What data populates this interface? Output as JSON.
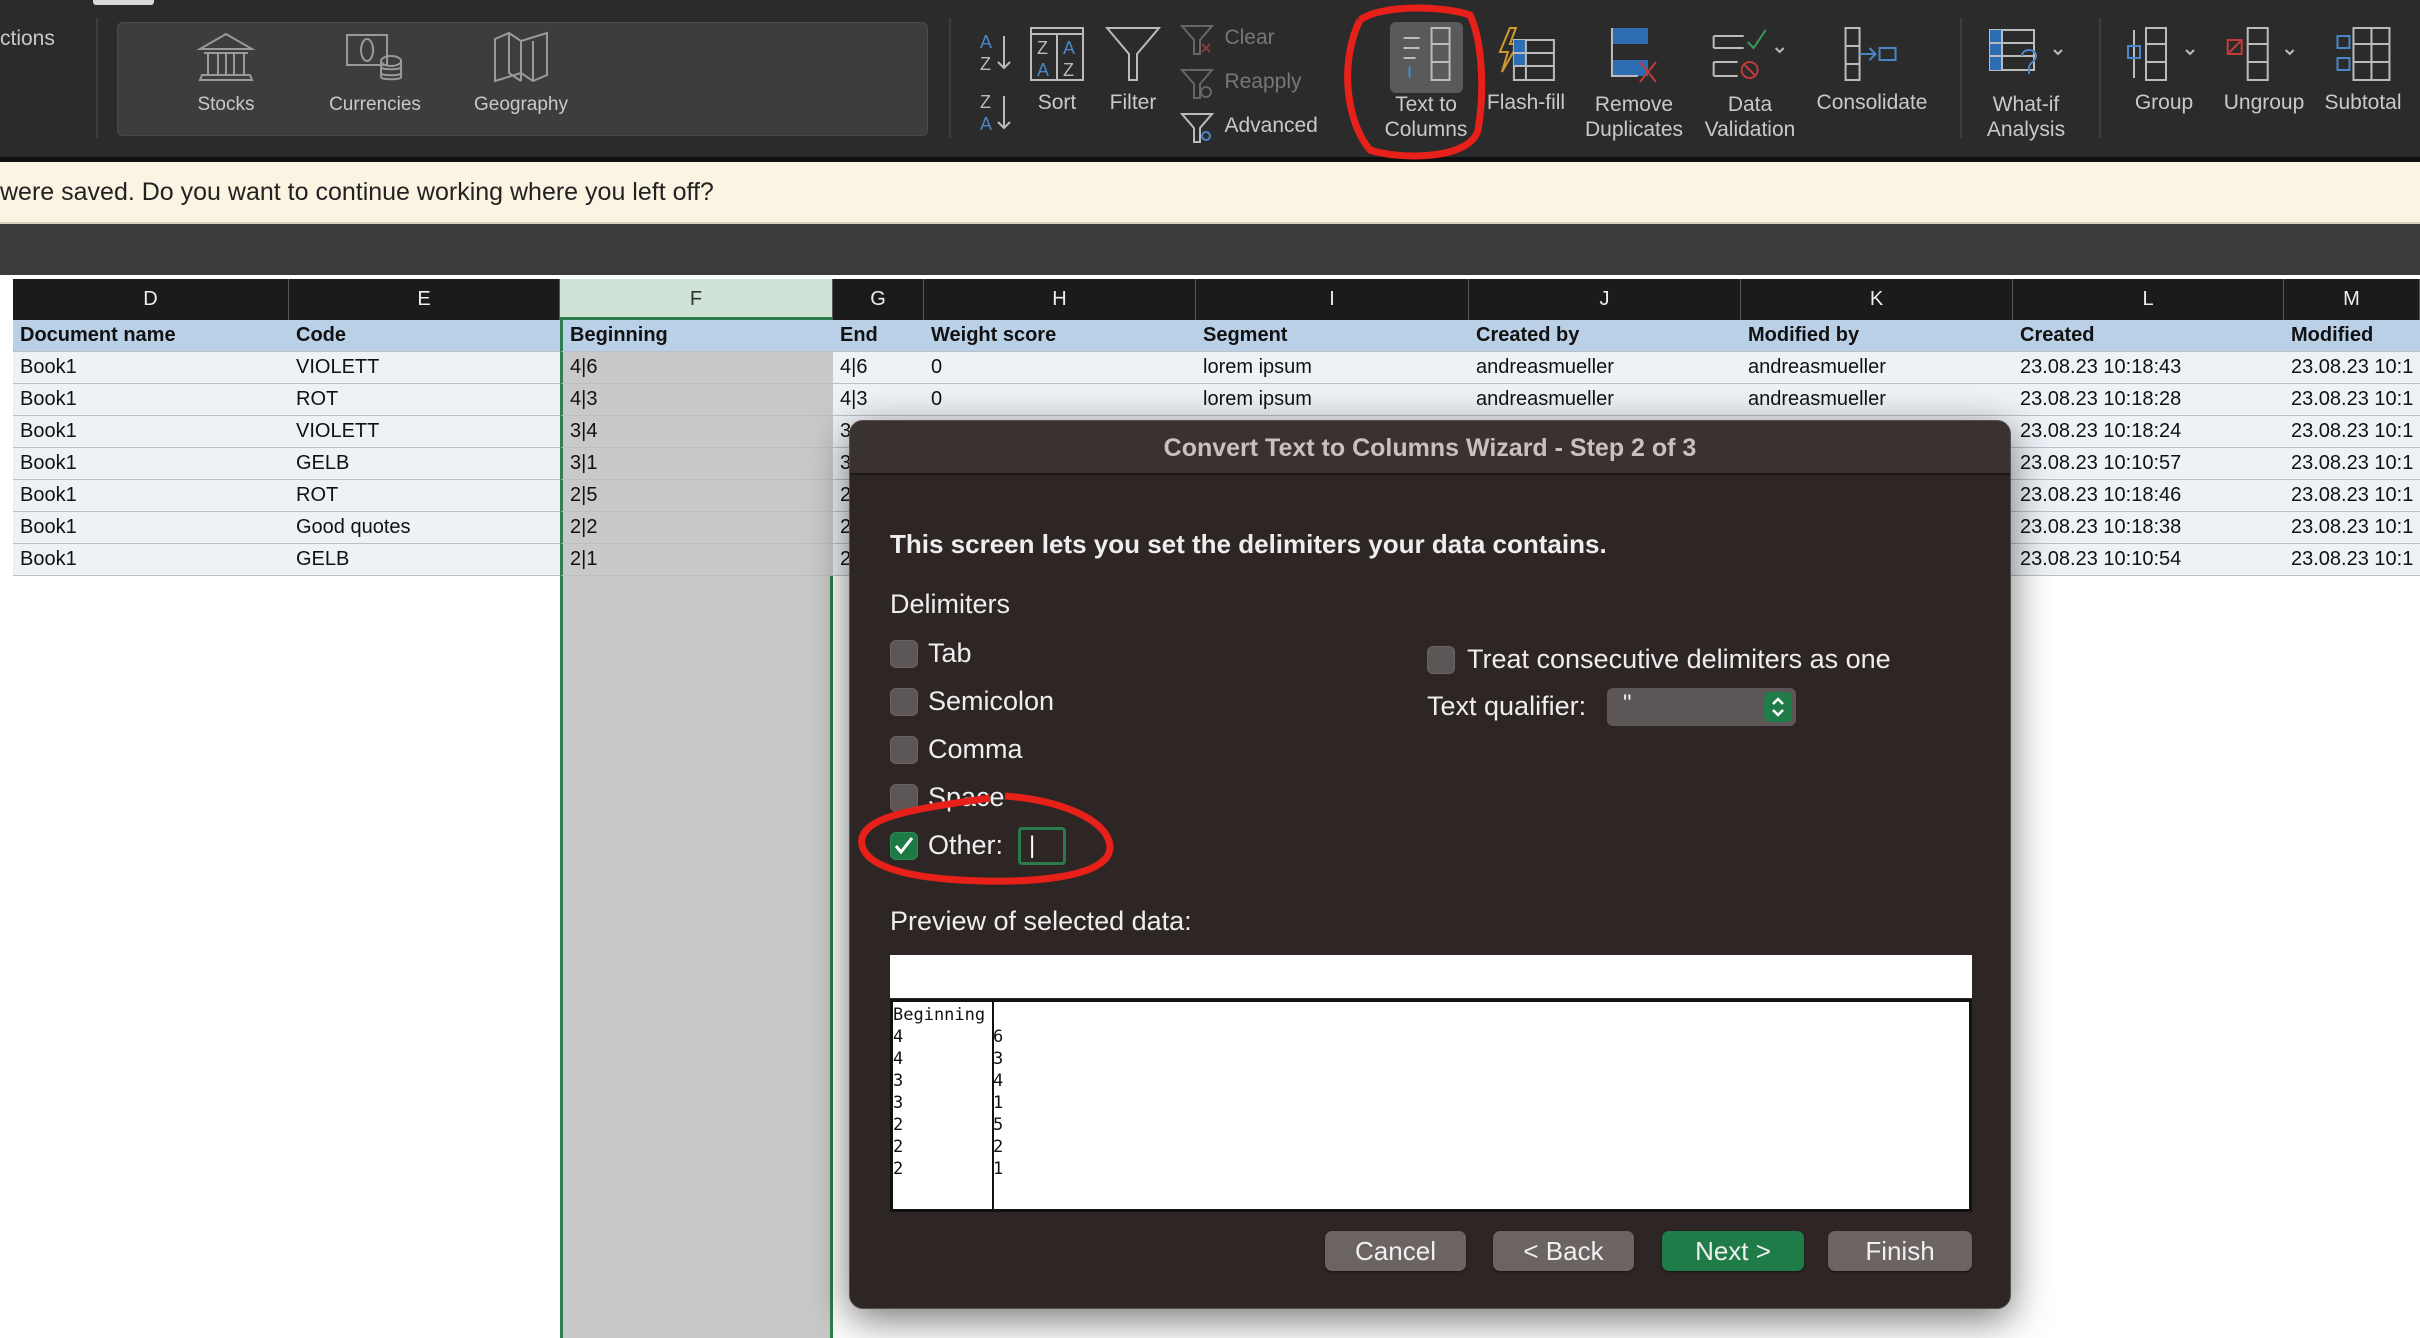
{
  "toolbar": {
    "left_cut_label": "ctions",
    "data_types": [
      {
        "label": "Stocks",
        "icon": "bank-icon"
      },
      {
        "label": "Currencies",
        "icon": "currency-icon"
      },
      {
        "label": "Geography",
        "icon": "map-icon"
      }
    ],
    "sort": "Sort",
    "filter": "Filter",
    "clear": "Clear",
    "reapply": "Reapply",
    "advanced": "Advanced",
    "text_to_columns": [
      "Text to",
      "Columns"
    ],
    "flash_fill": "Flash-fill",
    "remove_duplicates": [
      "Remove",
      "Duplicates"
    ],
    "data_validation": [
      "Data",
      "Validation"
    ],
    "consolidate": "Consolidate",
    "what_if": [
      "What-if",
      "Analysis"
    ],
    "group": "Group",
    "ungroup": "Ungroup",
    "subtotal": "Subtotal"
  },
  "notification": "were saved. Do you want to continue working where you left off?",
  "sheet": {
    "column_letters": [
      "D",
      "E",
      "F",
      "G",
      "H",
      "I",
      "J",
      "K",
      "L",
      "M"
    ],
    "headers": [
      "Document name",
      "Code",
      "Beginning",
      "End",
      "Weight score",
      "Segment",
      "Created by",
      "Modified by",
      "Created",
      "Modified"
    ],
    "rows": [
      [
        "Book1",
        "VIOLETT",
        "4|6",
        "4|6",
        "0",
        "lorem ipsum",
        "andreasmueller",
        "andreasmueller",
        "23.08.23 10:18:43",
        "23.08.23 10:1"
      ],
      [
        "Book1",
        "ROT",
        "4|3",
        "4|3",
        "0",
        "lorem ipsum",
        "andreasmueller",
        "andreasmueller",
        "23.08.23 10:18:28",
        "23.08.23 10:1"
      ],
      [
        "Book1",
        "VIOLETT",
        "3|4",
        "3",
        "",
        "",
        "",
        "",
        "23.08.23 10:18:24",
        "23.08.23 10:1"
      ],
      [
        "Book1",
        "GELB",
        "3|1",
        "3",
        "",
        "",
        "",
        "",
        "23.08.23 10:10:57",
        "23.08.23 10:1"
      ],
      [
        "Book1",
        "ROT",
        "2|5",
        "2",
        "",
        "",
        "",
        "",
        "23.08.23 10:18:46",
        "23.08.23 10:1"
      ],
      [
        "Book1",
        "Good quotes",
        "2|2",
        "2",
        "",
        "",
        "",
        "",
        "23.08.23 10:18:38",
        "23.08.23 10:1"
      ],
      [
        "Book1",
        "GELB",
        "2|1",
        "2",
        "",
        "",
        "",
        "",
        "23.08.23 10:10:54",
        "23.08.23 10:1"
      ]
    ]
  },
  "dialog": {
    "title": "Convert Text to Columns Wizard - Step 2 of 3",
    "instruction": "This screen lets you set the delimiters your data contains.",
    "delimiters_label": "Delimiters",
    "delimiters": [
      {
        "label": "Tab",
        "checked": false
      },
      {
        "label": "Semicolon",
        "checked": false
      },
      {
        "label": "Comma",
        "checked": false
      },
      {
        "label": "Space",
        "checked": false
      },
      {
        "label": "Other:",
        "checked": true
      }
    ],
    "other_value": "|",
    "treat_consecutive": {
      "label": "Treat consecutive delimiters as one",
      "checked": false
    },
    "text_qualifier_label": "Text qualifier:",
    "text_qualifier_value": "\"",
    "preview_label": "Preview of selected data:",
    "preview": {
      "col1": "Beginning\n4\n4\n3\n3\n2\n2\n2",
      "col2": "\n6\n3\n4\n1\n5\n2\n1"
    },
    "buttons": {
      "cancel": "Cancel",
      "back": "< Back",
      "next": "Next >",
      "finish": "Finish"
    }
  },
  "colors": {
    "accent_green": "#1f7b48",
    "annotation_red": "#e8201a",
    "header_blue": "#b9d0e7"
  }
}
